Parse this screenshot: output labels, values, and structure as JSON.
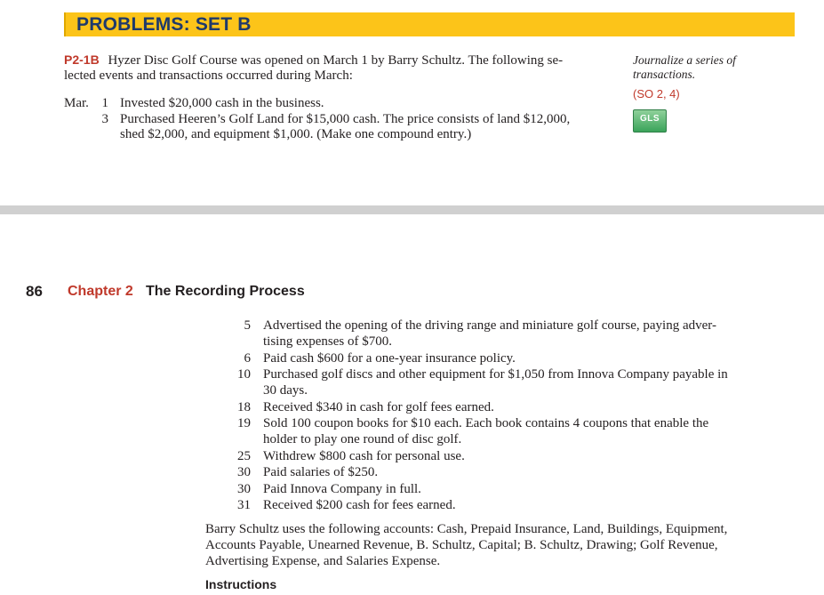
{
  "header": {
    "title": "PROBLEMS: SET B"
  },
  "problem": {
    "id": "P2-1B",
    "intro_line1": "Hyzer Disc Golf Course was opened on March 1 by Barry Schultz. The following se-",
    "intro_line2": "lected events and transactions occurred during March:",
    "margin_note_line1": "Journalize a series of",
    "margin_note_line2": "transactions.",
    "so_ref": "(SO 2, 4)",
    "icon_label": "GLS",
    "month": "Mar.",
    "first_transactions": [
      {
        "day": "1",
        "lines": [
          "Invested $20,000 cash in the business."
        ]
      },
      {
        "day": "3",
        "lines": [
          "Purchased Heeren’s Golf Land for $15,000 cash. The price consists of land $12,000,",
          "shed $2,000, and equipment $1,000. (Make one compound entry.)"
        ]
      }
    ]
  },
  "page": {
    "number": "86",
    "chapter_label": "Chapter 2",
    "chapter_title": "The Recording Process"
  },
  "transactions": [
    {
      "day": "5",
      "lines": [
        "Advertised the opening of the driving range and miniature golf course, paying adver-",
        "tising expenses of $700."
      ]
    },
    {
      "day": "6",
      "lines": [
        "Paid cash $600 for a one-year insurance policy."
      ]
    },
    {
      "day": "10",
      "lines": [
        "Purchased golf discs and other equipment for $1,050 from Innova Company payable in",
        "30 days."
      ]
    },
    {
      "day": "18",
      "lines": [
        "Received $340 in cash for golf fees earned."
      ]
    },
    {
      "day": "19",
      "lines": [
        "Sold 100 coupon books for $10 each. Each book contains 4 coupons that enable the",
        "holder to play one round of disc golf."
      ]
    },
    {
      "day": "25",
      "lines": [
        "Withdrew $800 cash for personal use."
      ]
    },
    {
      "day": "30",
      "lines": [
        "Paid salaries of $250."
      ]
    },
    {
      "day": "30",
      "lines": [
        "Paid Innova Company in full."
      ]
    },
    {
      "day": "31",
      "lines": [
        "Received $200 cash for fees earned."
      ]
    }
  ],
  "accounts_paragraph": [
    "Barry Schultz uses the following accounts: Cash, Prepaid Insurance, Land, Buildings, Equipment,",
    "Accounts Payable, Unearned Revenue, B. Schultz, Capital; B. Schultz, Drawing; Golf Revenue,",
    "Advertising Expense, and Salaries Expense."
  ],
  "instructions_heading": "Instructions"
}
